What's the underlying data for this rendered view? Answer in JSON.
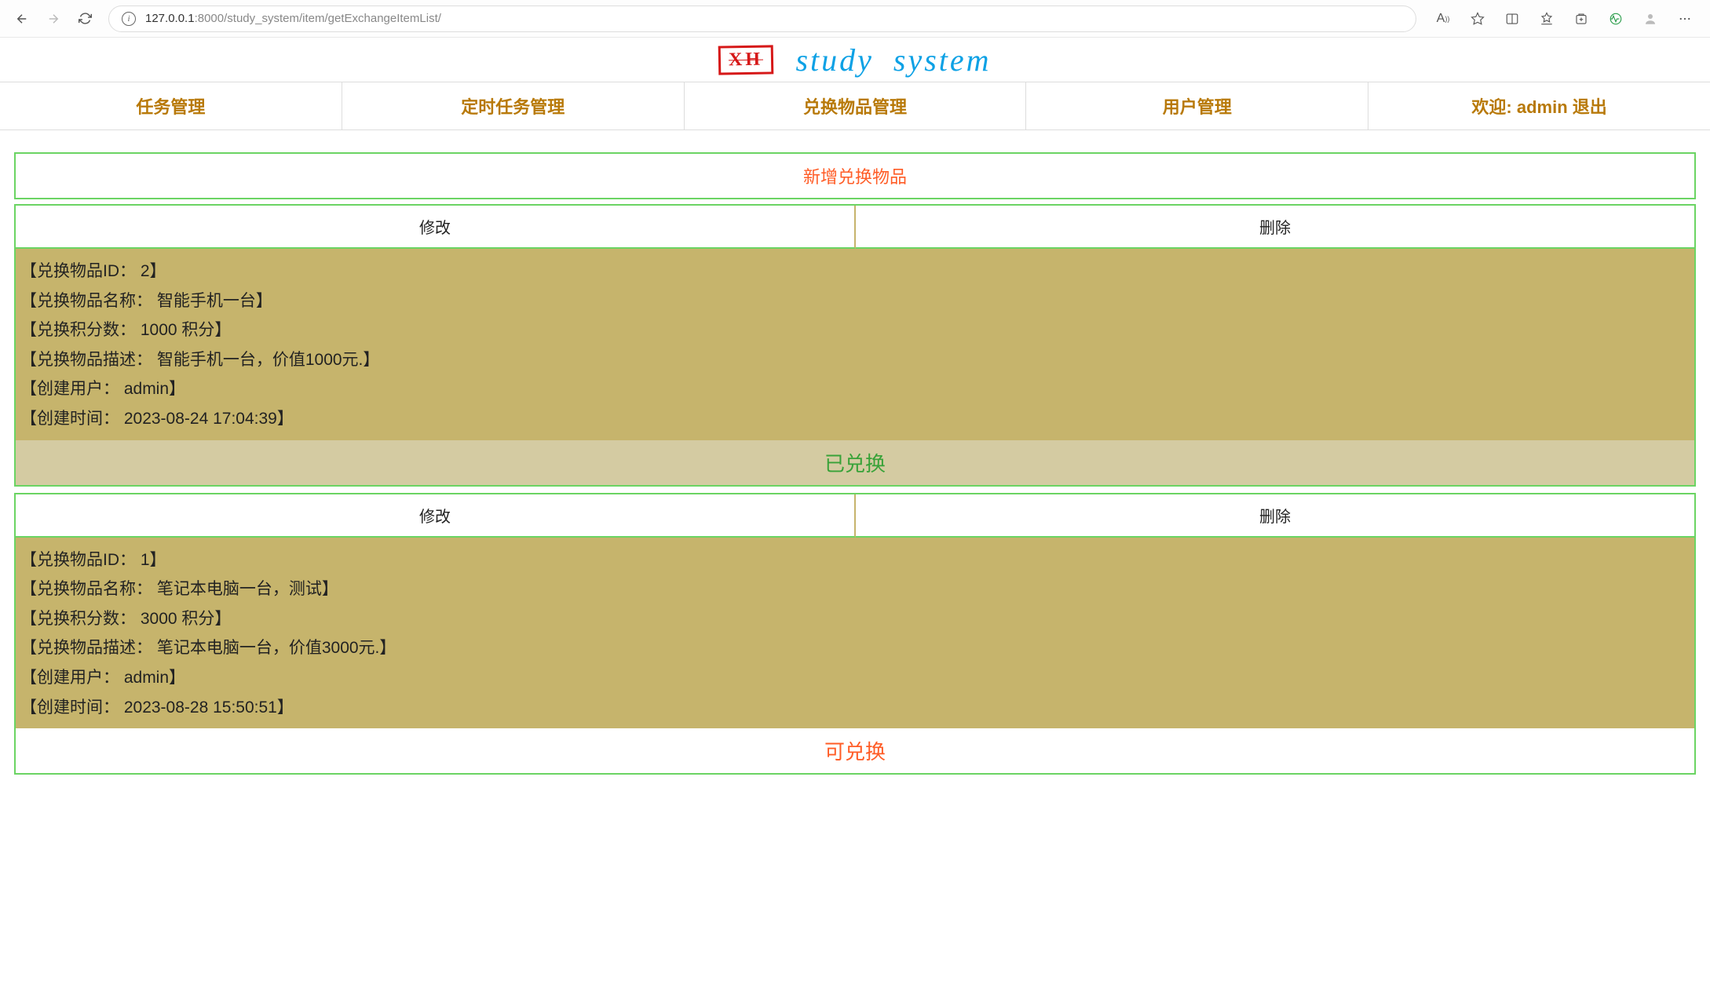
{
  "browser": {
    "url_host": "127.0.0.1",
    "url_port": ":8000",
    "url_path": "/study_system/item/getExchangeItemList/"
  },
  "header": {
    "logo_text": "XH",
    "title": "study  system"
  },
  "nav": {
    "items": [
      {
        "label": "任务管理"
      },
      {
        "label": "定时任务管理"
      },
      {
        "label": "兑换物品管理"
      },
      {
        "label": "用户管理"
      },
      {
        "label": "欢迎: admin 退出"
      }
    ]
  },
  "add_button": "新增兑换物品",
  "labels": {
    "edit": "修改",
    "delete": "删除",
    "item_id": "兑换物品ID",
    "item_name": "兑换物品名称",
    "points": "兑换积分数",
    "points_unit": "积分",
    "desc": "兑换物品描述",
    "create_user": "创建用户",
    "create_time": "创建时间",
    "redeemed": "已兑换",
    "available": "可兑换"
  },
  "items": [
    {
      "id": "2",
      "name": "智能手机一台",
      "points": "1000",
      "desc": "智能手机一台，价值1000元.",
      "create_user": "admin",
      "create_time": "2023-08-24 17:04:39",
      "status": "redeemed"
    },
    {
      "id": "1",
      "name": "笔记本电脑一台，测试",
      "points": "3000",
      "desc": "笔记本电脑一台，价值3000元.",
      "create_user": "admin",
      "create_time": "2023-08-28 15:50:51",
      "status": "available"
    }
  ]
}
